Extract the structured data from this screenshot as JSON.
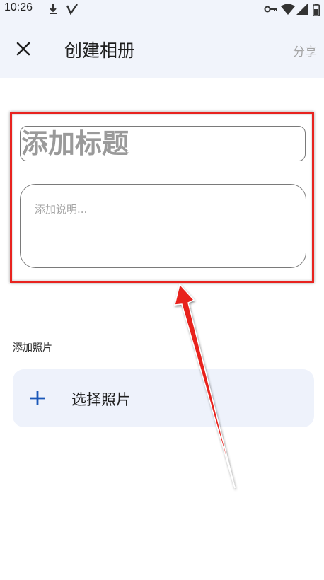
{
  "status_bar": {
    "time": "10:26",
    "icons": [
      "download-arrow-icon",
      "vpn-check-icon",
      "key-icon",
      "wifi-icon",
      "signal-icon",
      "battery-icon"
    ]
  },
  "app_bar": {
    "close_icon": "close-icon",
    "title": "创建相册",
    "share_label": "分享"
  },
  "form": {
    "title_placeholder": "添加标题",
    "description_placeholder": "添加说明..."
  },
  "photos": {
    "section_label": "添加照片",
    "select_label": "选择照片",
    "select_icon": "plus-icon"
  },
  "colors": {
    "accent": "#1a57b8",
    "highlight": "#e8231f",
    "appbar_bg": "#f1f4fb"
  }
}
